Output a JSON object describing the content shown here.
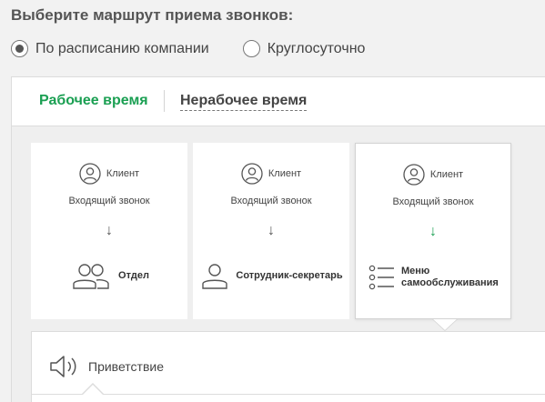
{
  "heading": "Выберите маршрут приема звонков:",
  "schedule_options": [
    {
      "label": "По расписанию компании",
      "checked": true
    },
    {
      "label": "Круглосуточно",
      "checked": false
    }
  ],
  "tabs": {
    "active": "Рабочее время",
    "inactive": "Нерабочее время"
  },
  "route_cards": [
    {
      "client": "Клиент",
      "incoming": "Входящий звонок",
      "arrow": "↓",
      "destination": "Отдел",
      "dest_icon": "group-icon",
      "selected": false
    },
    {
      "client": "Клиент",
      "incoming": "Входящий звонок",
      "arrow": "↓",
      "destination": "Сотрудник-секретарь",
      "dest_icon": "user-icon",
      "selected": false
    },
    {
      "client": "Клиент",
      "incoming": "Входящий звонок",
      "arrow": "↓",
      "destination_line1": "Меню",
      "destination_line2": "самообслуживания",
      "dest_icon": "list-icon",
      "selected": true
    }
  ],
  "greeting": {
    "label": "Приветствие",
    "icon": "speaker-icon"
  },
  "colors": {
    "accent_green": "#1a9f52",
    "text": "#444444",
    "background": "#f2f2f2"
  }
}
